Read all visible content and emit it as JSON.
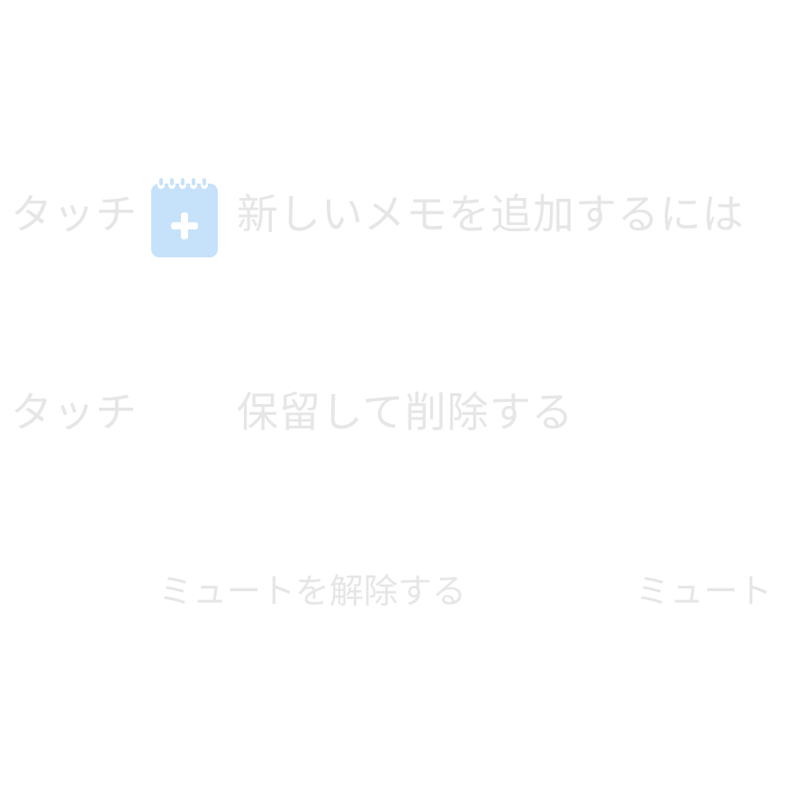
{
  "tutorial": {
    "add_note": {
      "touch_label": "タッチ",
      "icon": "add-memo-icon",
      "text": "新しいメモを追加するには"
    },
    "delete_note": {
      "touch_label": "タッチ",
      "text": "保留して削除する"
    }
  },
  "controls": {
    "unmute_label": "ミュートを解除する",
    "mute_label": "ミュート"
  },
  "colors": {
    "text": "#e6e6e6",
    "icon_fill": "#c6e1fa",
    "icon_plus": "#ffffff"
  }
}
